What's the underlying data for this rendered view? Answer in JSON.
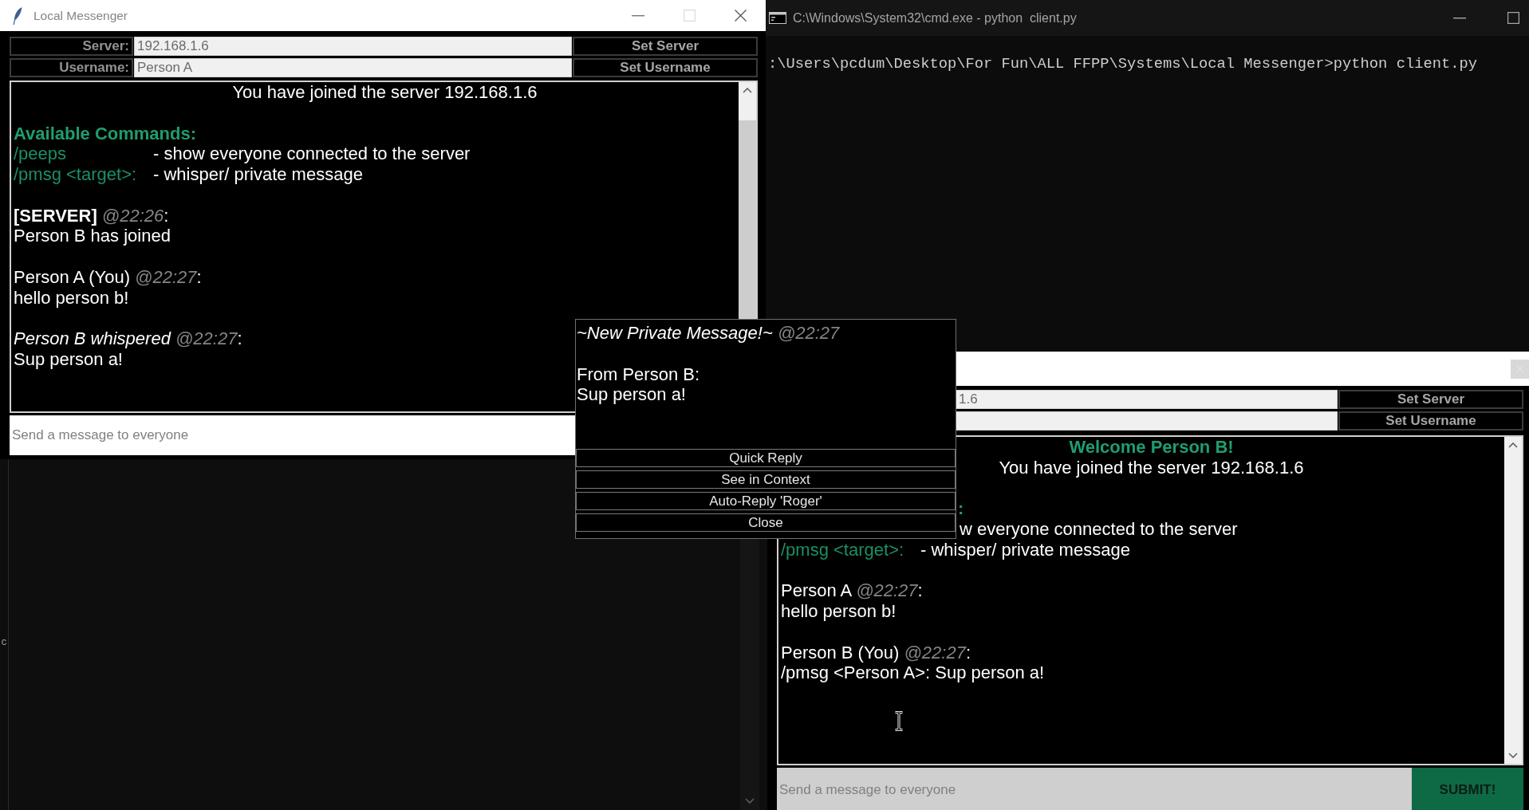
{
  "background_window": {
    "text": "c"
  },
  "console": {
    "title": "C:\\Windows\\System32\\cmd.exe - python  client.py",
    "lines": [
      ":\\Users\\pcdum\\Desktop\\For Fun\\ALL FFPP\\Systems\\Local Messenger>python client.py"
    ]
  },
  "messenger_a": {
    "title": "Local Messenger",
    "settings": [
      {
        "label": "Server:",
        "value": "192.168.1.6",
        "button": "Set Server"
      },
      {
        "label": "Username:",
        "value": "Person A",
        "button": "Set Username"
      }
    ],
    "chat": {
      "notice": "You have joined the server 192.168.1.6",
      "commands": {
        "title": "Available Commands:",
        "items": [
          {
            "command": "/peeps",
            "description": "- show everyone connected to the server"
          },
          {
            "command": "/pmsg <target>:",
            "description": "- whisper/ private message"
          }
        ]
      },
      "messages": [
        {
          "kind": "server",
          "sender": "[SERVER]",
          "time": "@22:26",
          "suffix": ":",
          "text": "Person B has joined"
        },
        {
          "kind": "user",
          "sender": "Person A (You)",
          "time": "@22:27",
          "suffix": ":",
          "text": "hello person b!"
        },
        {
          "kind": "whisper",
          "sender": "Person B whispered",
          "time": "@22:27",
          "suffix": ":",
          "text": "Sup person a!"
        }
      ]
    },
    "input": {
      "placeholder": "Send a message to everyone"
    }
  },
  "messenger_b": {
    "settings": [
      {
        "value": "1.6",
        "button": "Set Server"
      },
      {
        "button": "Set Username"
      }
    ],
    "chat": {
      "welcome": "Welcome Person B!",
      "notice": "You have joined the server 192.168.1.6",
      "commands": {
        "title": ":",
        "items": [
          {
            "description": "w everyone connected to the server"
          },
          {
            "command": "/pmsg <target>:",
            "description": "- whisper/ private message"
          }
        ]
      },
      "messages": [
        {
          "kind": "user",
          "sender": "Person A",
          "time": "@22:27",
          "suffix": ":",
          "text": "hello person b!"
        },
        {
          "kind": "user",
          "sender": "Person B (You)",
          "time": "@22:27",
          "suffix": ":",
          "text": "/pmsg <Person A>: Sup person a!"
        }
      ]
    },
    "input": {
      "placeholder": "Send a message to everyone"
    },
    "submit": "SUBMIT!"
  },
  "popup": {
    "title": "~New Private Message!~",
    "time": "@22:27",
    "lines": [
      "From Person B:",
      "Sup person a!"
    ],
    "buttons": [
      "Quick Reply",
      "See in Context",
      "Auto-Reply 'Roger'",
      "Close"
    ]
  }
}
